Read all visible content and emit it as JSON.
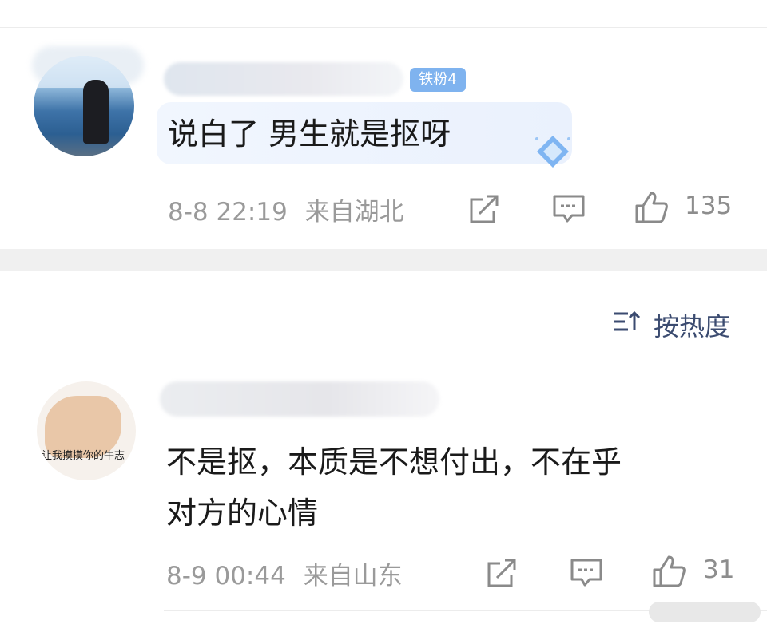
{
  "comment1": {
    "fan_badge": "铁粉4",
    "text": "说白了 男生就是抠呀",
    "date": "8-8 22:19",
    "location": "来自湖北",
    "likes": "135"
  },
  "sort": {
    "label": "按热度"
  },
  "comment2": {
    "avatar_caption": "让我摸摸你的牛志",
    "text_line1": "不是抠，本质是不想付出，不在乎",
    "text_line2": "对方的心情",
    "date": "8-9 00:44",
    "location": "来自山东",
    "likes": "31"
  }
}
